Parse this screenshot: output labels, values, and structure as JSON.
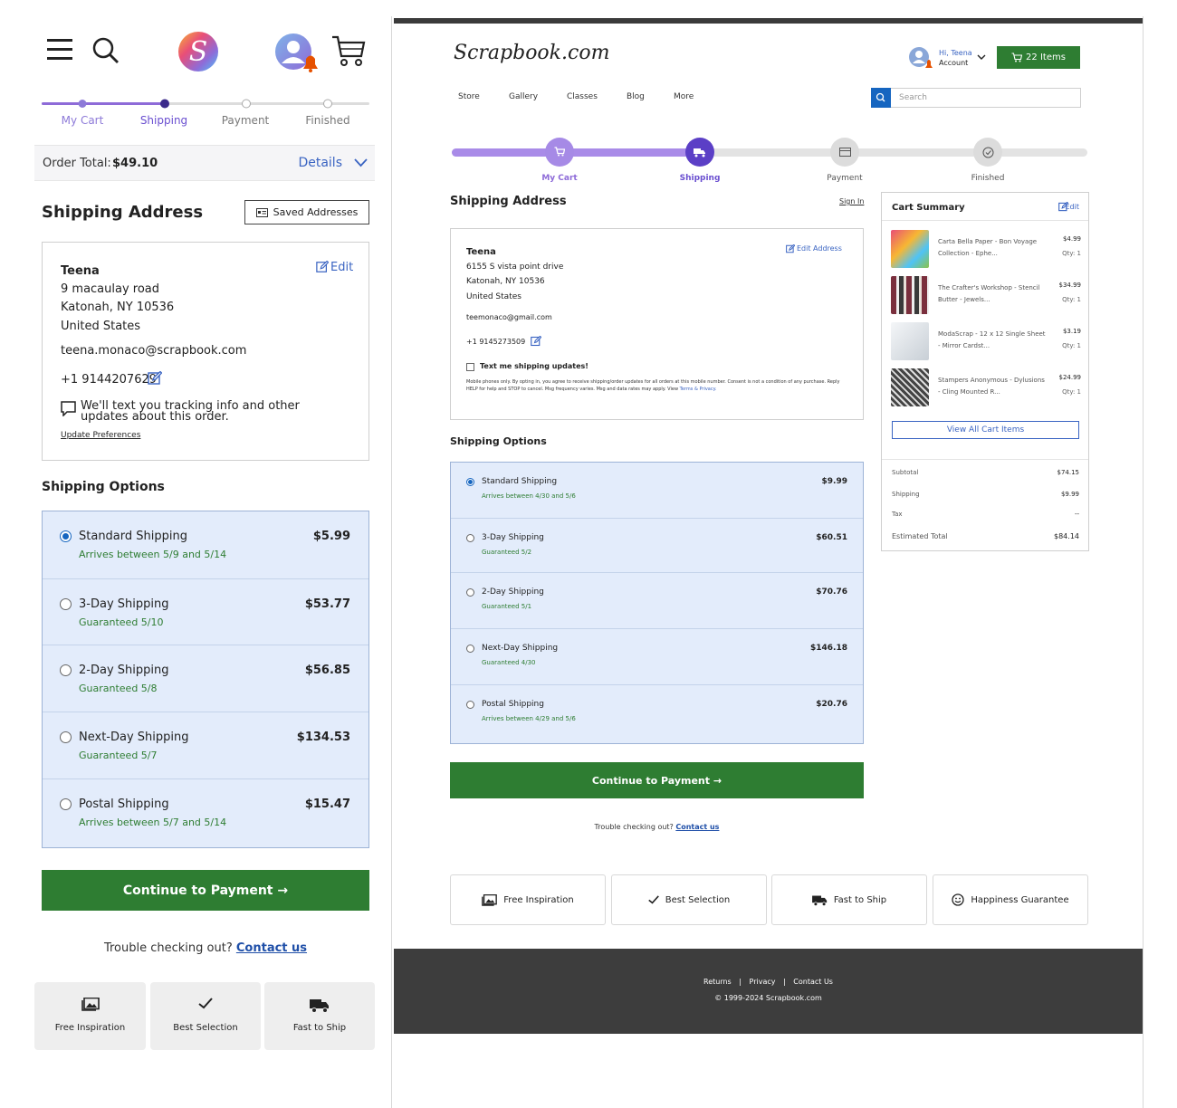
{
  "mobile": {
    "steps": [
      "My Cart",
      "Shipping",
      "Payment",
      "Finished"
    ],
    "order_total_label": "Order Total:",
    "order_total_value": "$49.10",
    "details_label": "Details",
    "shipping_address_title": "Shipping Address",
    "saved_addresses_label": "Saved Addresses",
    "address": {
      "name": "Teena",
      "line1": "9 macaulay road",
      "line2": "Katonah, NY 10536",
      "country": "United States",
      "email": "teena.monaco@scrapbook.com",
      "phone": "+1 9144207629",
      "edit_label": "Edit",
      "text_updates": "We'll text you tracking info and other updates about this order.",
      "update_prefs": "Update Preferences"
    },
    "shipping_options_title": "Shipping Options",
    "options": [
      {
        "name": "Standard Shipping",
        "sub": "Arrives between 5/9 and 5/14",
        "price": "$5.99",
        "selected": true
      },
      {
        "name": "3-Day Shipping",
        "sub": "Guaranteed 5/10",
        "price": "$53.77",
        "selected": false
      },
      {
        "name": "2-Day Shipping",
        "sub": "Guaranteed 5/8",
        "price": "$56.85",
        "selected": false
      },
      {
        "name": "Next-Day Shipping",
        "sub": "Guaranteed 5/7",
        "price": "$134.53",
        "selected": false
      },
      {
        "name": "Postal Shipping",
        "sub": "Arrives between 5/7 and 5/14",
        "price": "$15.47",
        "selected": false
      }
    ],
    "continue_label": "Continue to Payment →",
    "trouble_text": "Trouble checking out?",
    "contact_label": "Contact us",
    "features": [
      "Free Inspiration",
      "Best Selection",
      "Fast to Ship"
    ]
  },
  "desktop": {
    "logo": "Scrapbook.com",
    "account_greeting": "Hi, Teena",
    "account_label": "Account",
    "cart_button": "22 Items",
    "nav": [
      "Store",
      "Gallery",
      "Classes",
      "Blog",
      "More"
    ],
    "search_placeholder": "Search",
    "steps": [
      "My Cart",
      "Shipping",
      "Payment",
      "Finished"
    ],
    "shipping_address_title": "Shipping Address",
    "sign_in": "Sign In",
    "address": {
      "name": "Teena",
      "line1": "6155 S vista point drive",
      "line2": "Katonah, NY 10536",
      "country": "United States",
      "email": "teemonaco@gmail.com",
      "phone": "+1 9145273509",
      "edit_label": "Edit Address",
      "text_me": "Text me shipping updates!",
      "disclaimer": "Mobile phones only. By opting in, you agree to receive shipping/order updates for all orders at this mobile number. Consent is not a condition of any purchase. Reply HELP for help and STOP to cancel. Msg frequency varies. Msg and data rates may apply. View",
      "terms": "Terms & Privacy."
    },
    "shipping_options_title": "Shipping Options",
    "options": [
      {
        "name": "Standard Shipping",
        "sub": "Arrives between 4/30 and 5/6",
        "price": "$9.99",
        "selected": true
      },
      {
        "name": "3-Day Shipping",
        "sub": "Guaranteed 5/2",
        "price": "$60.51",
        "selected": false
      },
      {
        "name": "2-Day Shipping",
        "sub": "Guaranteed 5/1",
        "price": "$70.76",
        "selected": false
      },
      {
        "name": "Next-Day Shipping",
        "sub": "Guaranteed 4/30",
        "price": "$146.18",
        "selected": false
      },
      {
        "name": "Postal Shipping",
        "sub": "Arrives between 4/29 and 5/6",
        "price": "$20.76",
        "selected": false
      }
    ],
    "continue_label": "Continue to Payment →",
    "trouble_text": "Trouble checking out?",
    "contact_label": "Contact us",
    "cart_summary": {
      "title": "Cart Summary",
      "edit_label": "Edit",
      "items": [
        {
          "name": "Carta Bella Paper - Bon Voyage Collection - Ephe...",
          "price": "$4.99",
          "qty": "Qty: 1",
          "color": "#d94c6a"
        },
        {
          "name": "The Crafter's Workshop - Stencil Butter - Jewels...",
          "price": "$34.99",
          "qty": "Qty: 1",
          "color": "#8b3a4a"
        },
        {
          "name": "ModaScrap - 12 x 12 Single Sheet - Mirror Cardst...",
          "price": "$3.19",
          "qty": "Qty: 1",
          "color": "#d8dde2"
        },
        {
          "name": "Stampers Anonymous - Dylusions - Cling Mounted R...",
          "price": "$24.99",
          "qty": "Qty: 1",
          "color": "#5a5a5a"
        }
      ],
      "view_all": "View All Cart Items",
      "subtotal_label": "Subtotal",
      "subtotal": "$74.15",
      "shipping_label": "Shipping",
      "shipping": "$9.99",
      "tax_label": "Tax",
      "tax": "--",
      "estimated_label": "Estimated Total",
      "estimated": "$84.14"
    },
    "features": [
      "Free Inspiration",
      "Best Selection",
      "Fast to Ship",
      "Happiness Guarantee"
    ],
    "footer_links": [
      "Returns",
      "Privacy",
      "Contact Us"
    ],
    "copyright": "© 1999-2024 Scrapbook.com"
  }
}
